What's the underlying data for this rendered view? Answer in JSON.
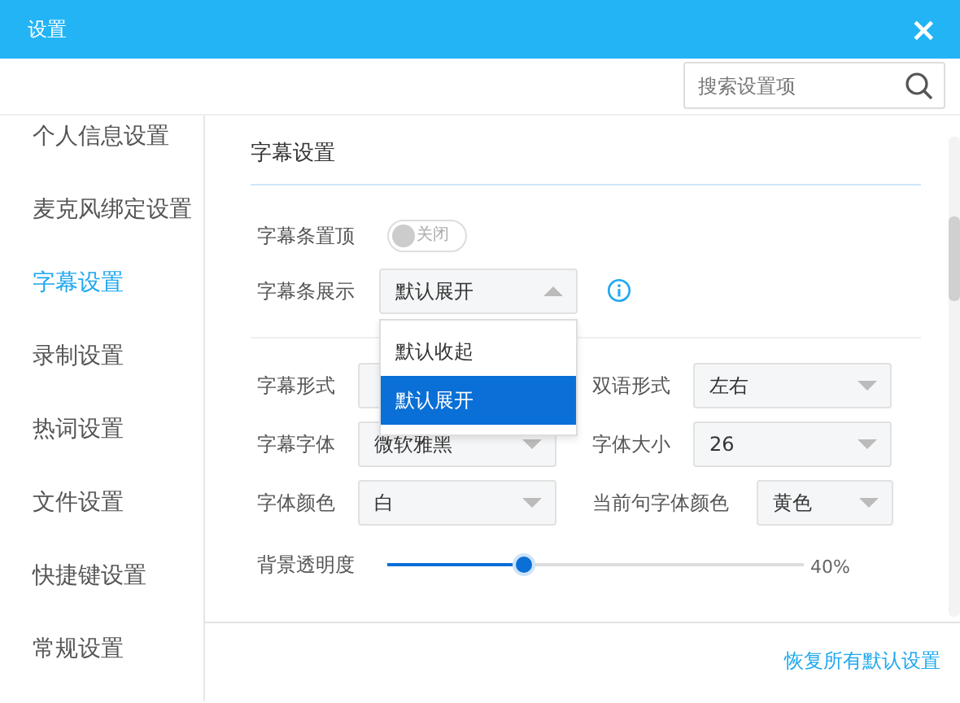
{
  "window": {
    "title": "设置",
    "close": "×"
  },
  "search": {
    "placeholder": "搜索设置项"
  },
  "sidebar": {
    "items": [
      {
        "label": "个人信息设置",
        "selected": false
      },
      {
        "label": "麦克风绑定设置",
        "selected": false
      },
      {
        "label": "字幕设置",
        "selected": true
      },
      {
        "label": "录制设置",
        "selected": false
      },
      {
        "label": "热词设置",
        "selected": false
      },
      {
        "label": "文件设置",
        "selected": false
      },
      {
        "label": "快捷键设置",
        "selected": false
      },
      {
        "label": "常规设置",
        "selected": false
      }
    ]
  },
  "section": {
    "title": "字幕设置"
  },
  "pin_row": {
    "label": "字幕条置顶",
    "toggle": {
      "on": false,
      "text": "关闭"
    }
  },
  "display_row": {
    "label": "字幕条展示",
    "value": "默认展开",
    "expanded": true,
    "options": [
      {
        "label": "默认收起",
        "selected": false
      },
      {
        "label": "默认展开",
        "selected": true
      }
    ]
  },
  "fields": [
    [
      {
        "label": "字幕形式"
      },
      {
        "label": "双语形式",
        "value": "左右"
      }
    ],
    [
      {
        "label": "字幕字体",
        "value": "微软雅黑"
      },
      {
        "label": "字体大小",
        "value": "26"
      }
    ],
    [
      {
        "label": "字体颜色",
        "value": "白"
      },
      {
        "label": "当前句字体颜色",
        "value": "黄色"
      }
    ]
  ],
  "opacity": {
    "label": "背景透明度",
    "level": 0.33,
    "reading": "40%"
  },
  "footer": {
    "reset_link": "恢复所有默认设置"
  }
}
